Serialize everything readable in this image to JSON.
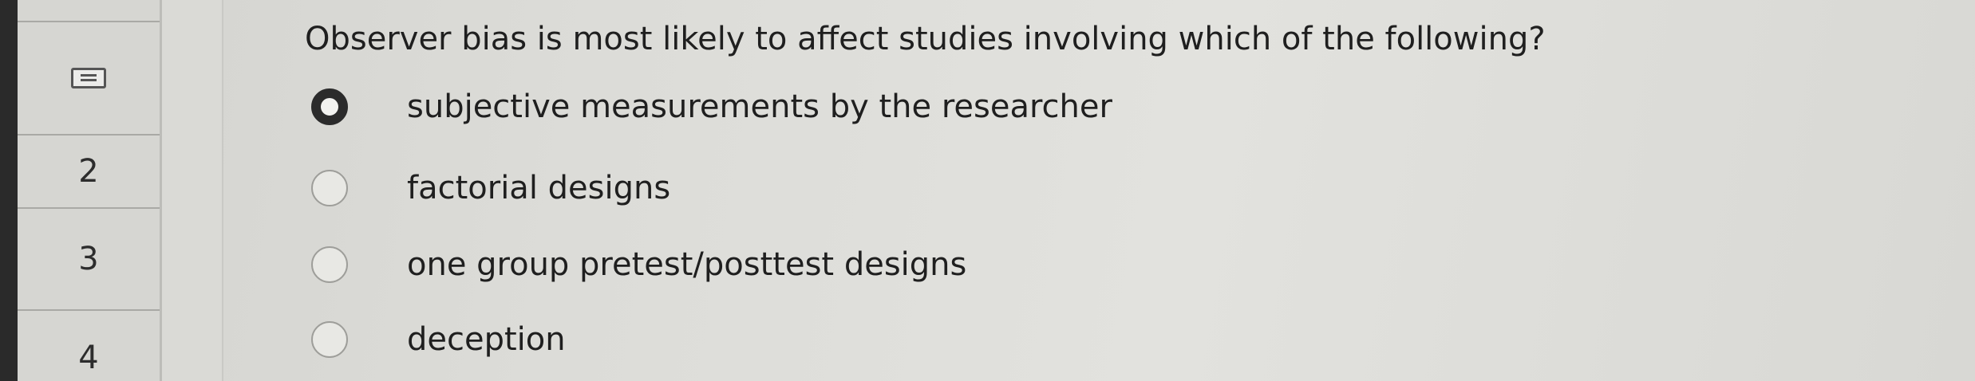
{
  "question": {
    "text": "Observer bias is most likely to affect studies involving which of the following?"
  },
  "nav": {
    "items": [
      {
        "label": "",
        "icon": "document-lines-icon",
        "current": true
      },
      {
        "label": "2"
      },
      {
        "label": "3"
      },
      {
        "label": "4"
      }
    ]
  },
  "options": [
    {
      "label": "subjective measurements by the researcher",
      "selected": true
    },
    {
      "label": "factorial designs",
      "selected": false
    },
    {
      "label": "one group pretest/posttest designs",
      "selected": false
    },
    {
      "label": "deception",
      "selected": false
    }
  ]
}
